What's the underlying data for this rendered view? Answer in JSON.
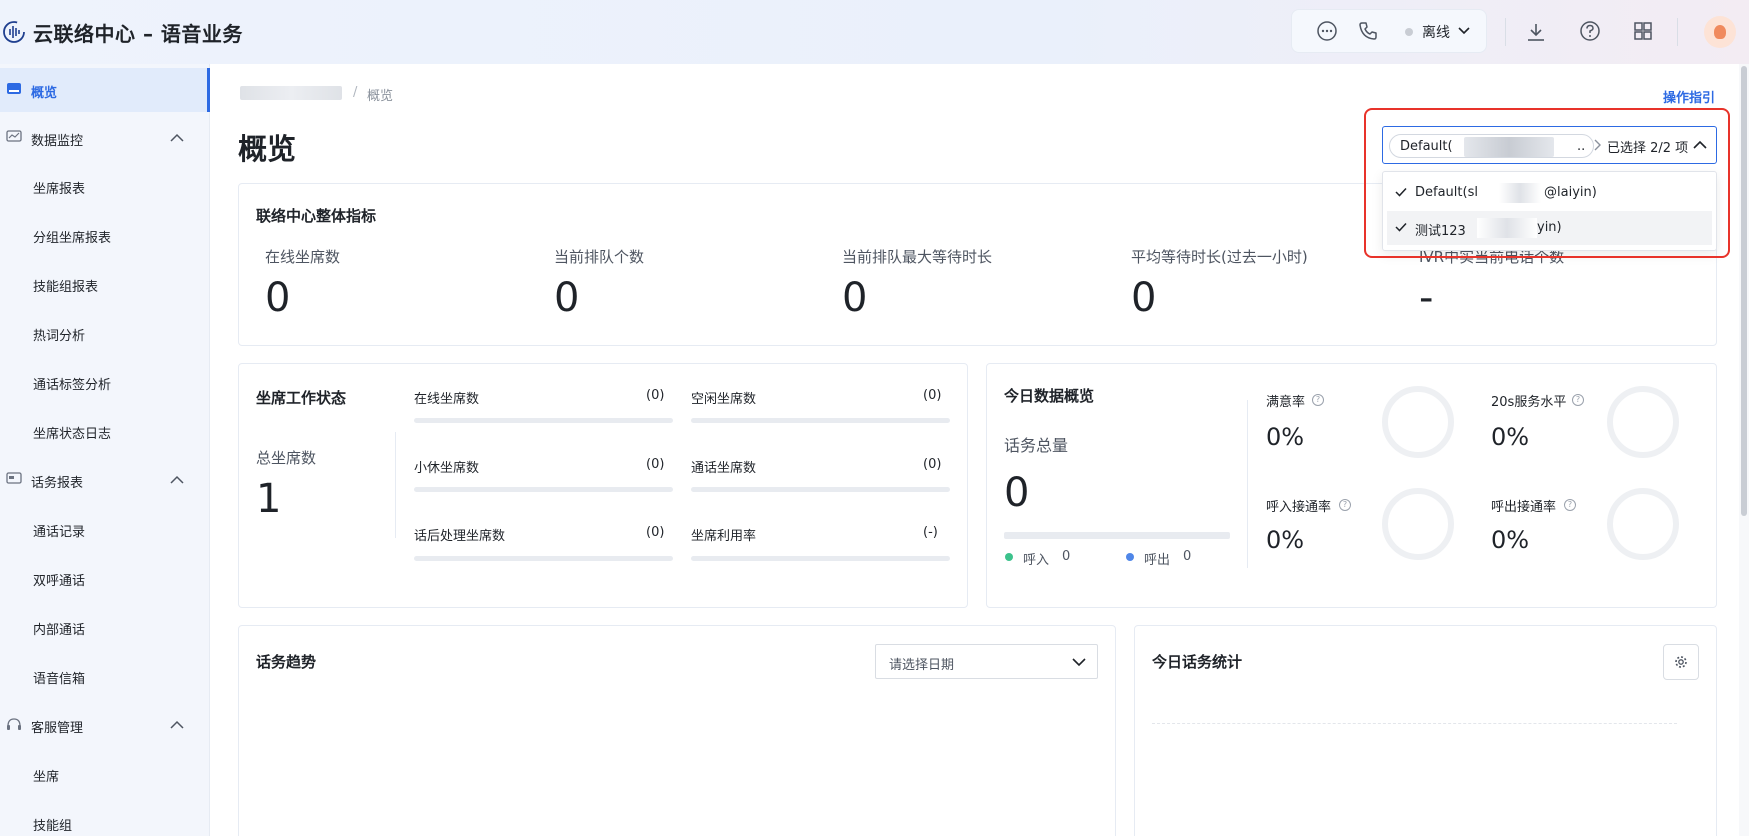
{
  "header": {
    "app_title": "云联络中心 – 语音业务",
    "status": "离线",
    "icons": [
      "chat-icon",
      "phone-icon",
      "download-icon",
      "help-icon",
      "apps-icon"
    ]
  },
  "sidebar": {
    "items": [
      {
        "label": "概览",
        "type": "top",
        "icon": "overview-icon",
        "active": true
      },
      {
        "label": "数据监控",
        "type": "top",
        "icon": "monitor-icon",
        "expanded": true
      },
      {
        "label": "坐席报表",
        "type": "sub"
      },
      {
        "label": "分组坐席报表",
        "type": "sub"
      },
      {
        "label": "技能组报表",
        "type": "sub"
      },
      {
        "label": "热词分析",
        "type": "sub"
      },
      {
        "label": "通话标签分析",
        "type": "sub"
      },
      {
        "label": "坐席状态日志",
        "type": "sub"
      },
      {
        "label": "话务报表",
        "type": "top",
        "icon": "report-icon",
        "expanded": true
      },
      {
        "label": "通话记录",
        "type": "sub"
      },
      {
        "label": "双呼通话",
        "type": "sub"
      },
      {
        "label": "内部通话",
        "type": "sub"
      },
      {
        "label": "语音信箱",
        "type": "sub"
      },
      {
        "label": "客服管理",
        "type": "top",
        "icon": "headset-icon",
        "expanded": true
      },
      {
        "label": "坐席",
        "type": "sub"
      },
      {
        "label": "技能组",
        "type": "sub"
      }
    ]
  },
  "breadcrumb": {
    "separator": "/",
    "current": "概览"
  },
  "guide_link": "操作指引",
  "page_title": "概览",
  "instance_select": {
    "tag_label": "Default(",
    "tag_ellipsis": "..",
    "count_text": "已选择 2/2 项",
    "options": [
      {
        "prefix": "Default(sl",
        "suffix": "@laiyin)",
        "checked": true
      },
      {
        "prefix": "测试123",
        "suffix": "yin)",
        "checked": true
      }
    ]
  },
  "overall": {
    "title": "联络中心整体指标",
    "metrics": [
      {
        "label": "在线坐席数",
        "value": "0"
      },
      {
        "label": "当前排队个数",
        "value": "0"
      },
      {
        "label": "当前排队最大等待时长",
        "value": "0"
      },
      {
        "label": "平均等待时长(过去一小时)",
        "value": "0"
      },
      {
        "label": "IVR中实当前电话个数",
        "value": "-"
      }
    ]
  },
  "agent_status": {
    "title": "坐席工作状态",
    "total_label": "总坐席数",
    "total_value": "1",
    "items": [
      {
        "label": "在线坐席数",
        "count": "(0)",
        "fill": 0
      },
      {
        "label": "空闲坐席数",
        "count": "(0)",
        "fill": 0
      },
      {
        "label": "小休坐席数",
        "count": "(0)",
        "fill": 0
      },
      {
        "label": "通话坐席数",
        "count": "(0)",
        "fill": 0
      },
      {
        "label": "话后处理坐席数",
        "count": "(0)",
        "fill": 0
      },
      {
        "label": "坐席利用率",
        "count": "(-)",
        "fill": 0
      }
    ]
  },
  "today_overview": {
    "title": "今日数据概览",
    "total_label": "话务总量",
    "total_value": "0",
    "inbound_label": "呼入",
    "inbound_value": "0",
    "outbound_label": "呼出",
    "outbound_value": "0",
    "rates": [
      {
        "label": "满意率",
        "value": "0%"
      },
      {
        "label": "20s服务水平",
        "value": "0%"
      },
      {
        "label": "呼入接通率",
        "value": "0%"
      },
      {
        "label": "呼出接通率",
        "value": "0%"
      }
    ],
    "colors": {
      "inbound": "#3cc28c",
      "outbound": "#4f86e8"
    }
  },
  "trend": {
    "title": "话务趋势",
    "date_placeholder": "请选择日期"
  },
  "today_stats": {
    "title": "今日话务统计"
  },
  "help_glyph": "?"
}
